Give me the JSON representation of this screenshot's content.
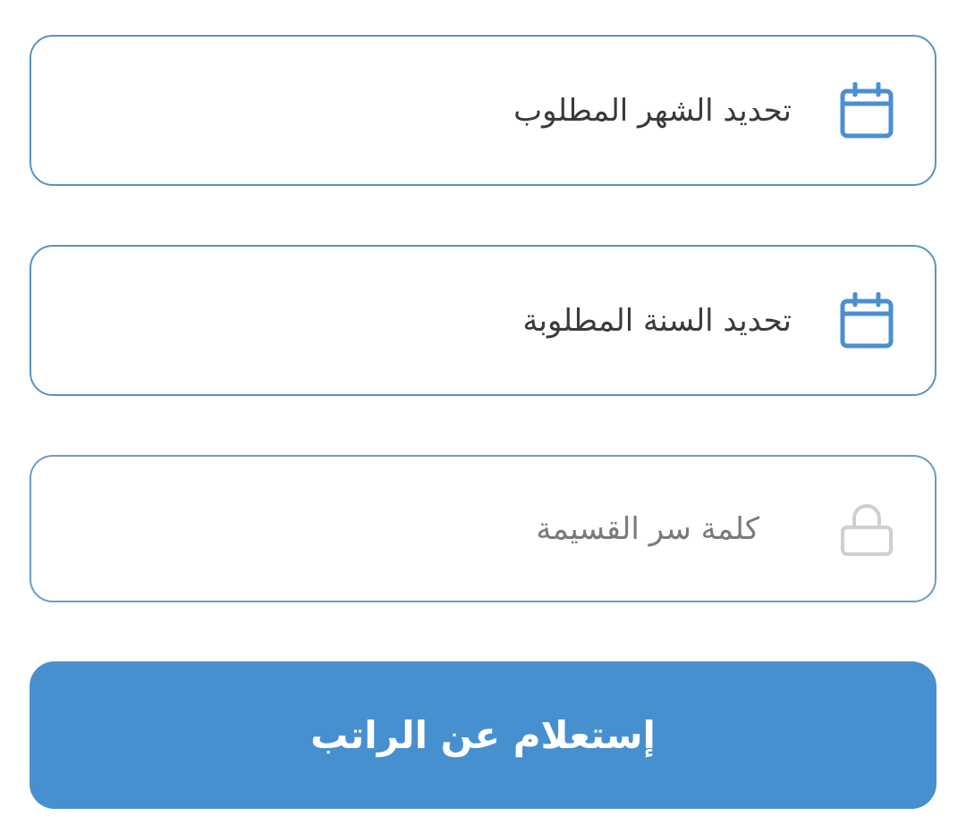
{
  "form": {
    "month_field": {
      "label": "تحديد الشهر المطلوب",
      "icon": "calendar-icon"
    },
    "year_field": {
      "label": "تحديد السنة المطلوبة",
      "icon": "calendar-icon"
    },
    "password_field": {
      "placeholder": "كلمة سر القسيمة",
      "icon": "lock-icon"
    },
    "submit_label": "إستعلام عن الراتب"
  },
  "colors": {
    "accent": "#4790cf",
    "border": "#5b93bf",
    "calendar_icon": "#4a8fd0",
    "lock_icon": "#cfcfcf"
  }
}
